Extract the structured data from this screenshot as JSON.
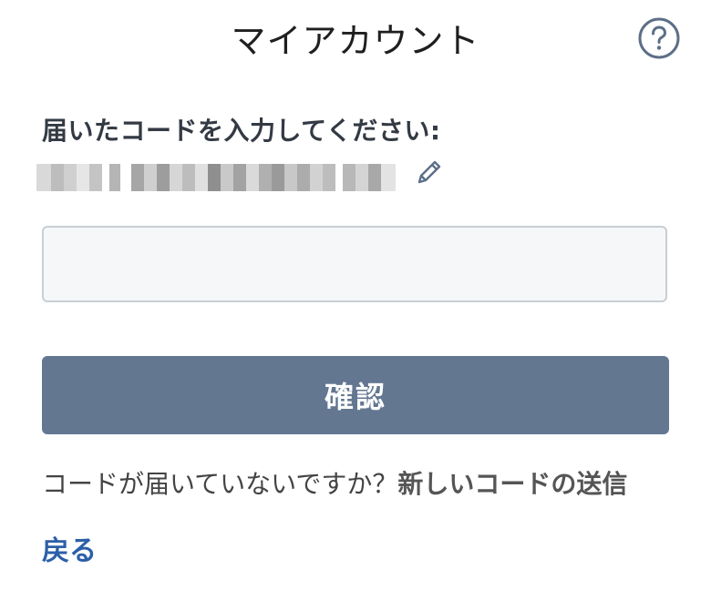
{
  "header": {
    "title": "マイアカウント",
    "help_icon": "question-circle-icon"
  },
  "verification": {
    "prompt": "届いたコードを入力してください:",
    "masked_email_note": "pixelated email address",
    "edit_icon": "pencil-icon",
    "code_input_value": "",
    "code_input_placeholder": ""
  },
  "actions": {
    "confirm_label": "確認",
    "resend_question": "コードが届いていないですか？",
    "resend_link": "新しいコードの送信",
    "back_label": "戻る"
  },
  "colors": {
    "confirm_button": "#637791",
    "back_link": "#2c5fa8",
    "help_icon": "#5d6f87",
    "input_border": "#c9ced6"
  }
}
